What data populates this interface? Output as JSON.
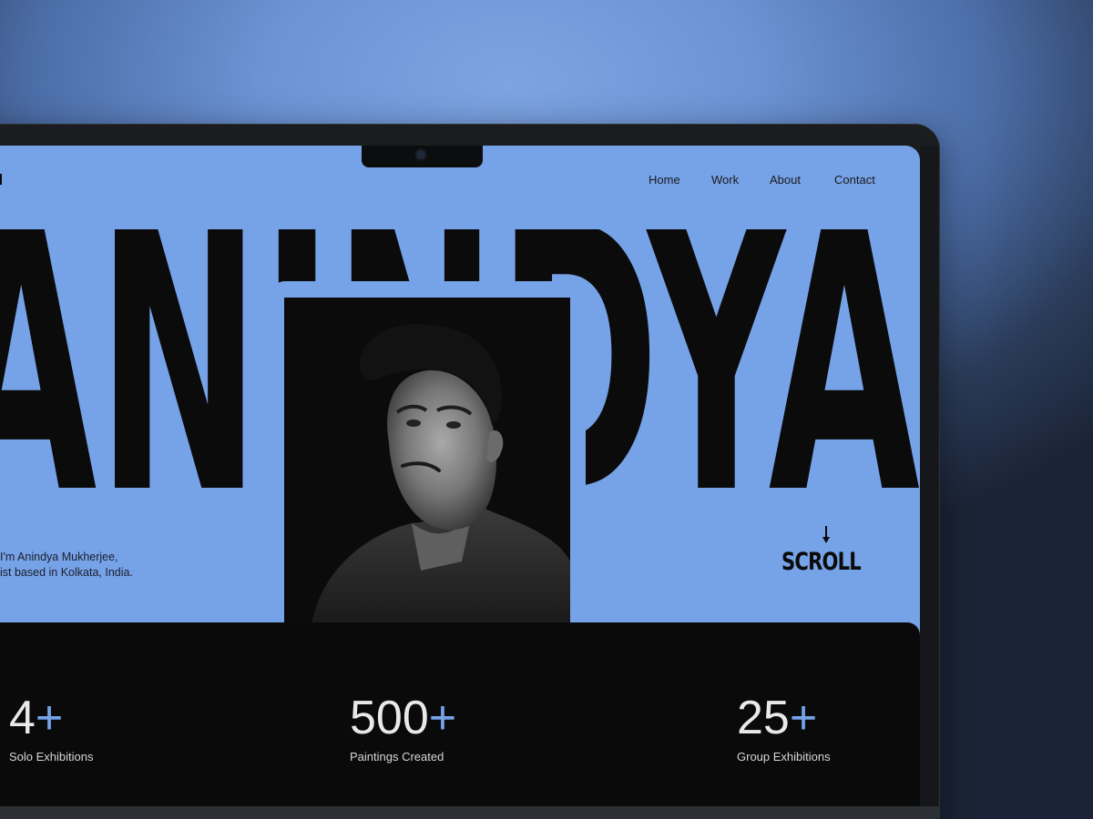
{
  "nav": {
    "items": [
      "Home",
      "Work",
      "About",
      "Contact"
    ]
  },
  "hero": {
    "name_visible": "ANINDYA",
    "intro_line1": "I'm Anindya Mukherjee,",
    "intro_line2": "ist based in Kolkata, India.",
    "scroll_label": "SCROLL"
  },
  "stats": [
    {
      "value": "4",
      "suffix": "+",
      "label": "Solo Exhibitions"
    },
    {
      "value": "500",
      "suffix": "+",
      "label": "Paintings Created"
    },
    {
      "value": "25",
      "suffix": "+",
      "label": "Group Exhibitions"
    }
  ],
  "colors": {
    "accent": "#76a2e8",
    "dark": "#0a0a0a",
    "text_light": "#e9e9e9"
  },
  "icons": {
    "scroll_arrow": "arrow-down-icon",
    "camera": "camera-icon"
  }
}
